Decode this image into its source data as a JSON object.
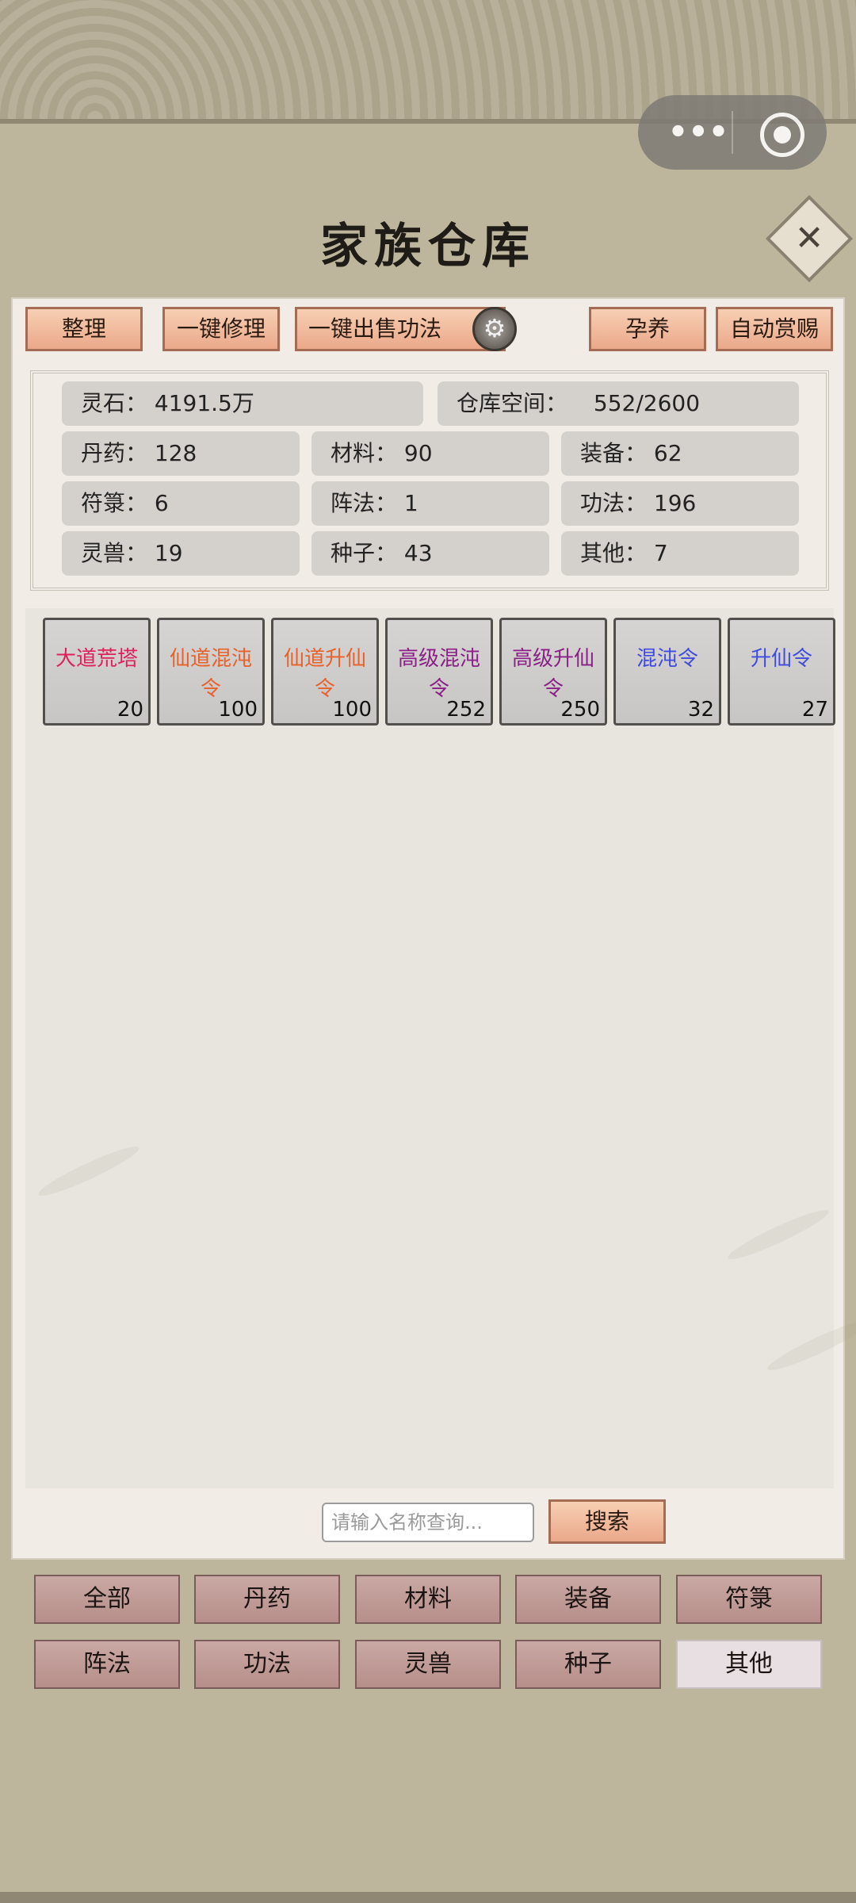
{
  "header": {
    "more_glyph": "•••",
    "title": "家族仓库",
    "close_glyph": "✕"
  },
  "toolbar": {
    "organize": "整理",
    "repair_all": "一键修理",
    "sell_skills": "一键出售功法",
    "gear_glyph": "⚙",
    "nurture": "孕养",
    "auto_reward": "自动赏赐"
  },
  "stats": {
    "spirit_stones": "灵石：  4191.5万",
    "warehouse_space_label": "仓库空间：",
    "warehouse_space_value": "552/2600",
    "pills": "丹药：  128",
    "materials": "材料：  90",
    "equipment": "装备：  62",
    "talismans": "符箓：  6",
    "formations": "阵法：  1",
    "skills": "功法：  196",
    "spirit_beasts": "灵兽：  19",
    "seeds": "种子：  43",
    "others": "其他：  7"
  },
  "items": [
    {
      "name": "大道荒塔",
      "qty": "20",
      "color": "#e0205a"
    },
    {
      "name": "仙道混沌令",
      "qty": "100",
      "color": "#e8612a"
    },
    {
      "name": "仙道升仙令",
      "qty": "100",
      "color": "#e8612a"
    },
    {
      "name": "高级混沌令",
      "qty": "252",
      "color": "#8a1f86"
    },
    {
      "name": "高级升仙令",
      "qty": "250",
      "color": "#8a1f86"
    },
    {
      "name": "混沌令",
      "qty": "32",
      "color": "#3f4be0"
    },
    {
      "name": "升仙令",
      "qty": "27",
      "color": "#3f4be0"
    }
  ],
  "search": {
    "placeholder": "请输入名称查询...",
    "button": "搜索"
  },
  "categories": {
    "all": "全部",
    "pills": "丹药",
    "materials": "材料",
    "equipment": "装备",
    "talismans": "符箓",
    "formations": "阵法",
    "skills": "功法",
    "spirit_beasts": "灵兽",
    "seeds": "种子",
    "others": "其他",
    "active": "其他"
  }
}
